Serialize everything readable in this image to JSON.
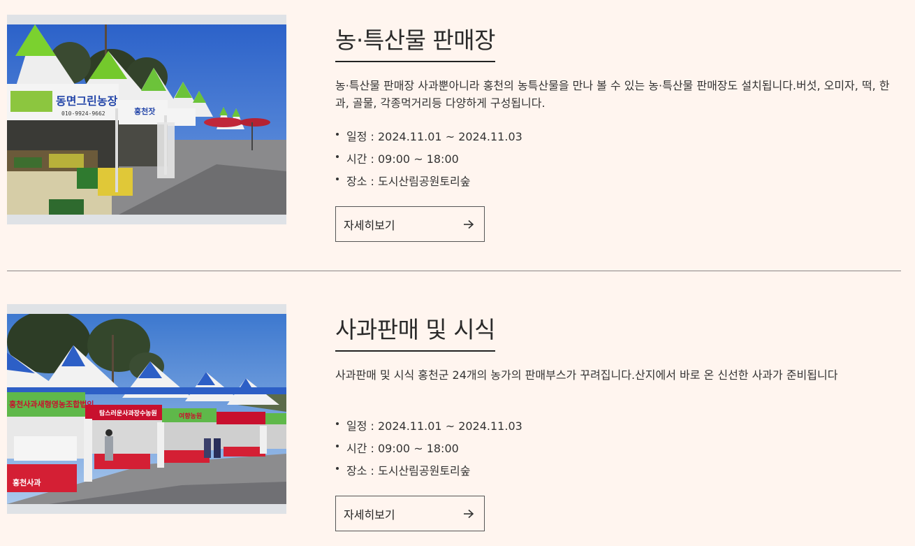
{
  "events": [
    {
      "title": "농·특산물 판매장",
      "description": "농·특산물 판매장 사과뿐아니라 홍천의 농특산물을 만나 볼 수 있는 농·특산물 판매장도 설치됩니다.버섯, 오미자, 떡, 한과, 골물, 각종먹거리등 다양하게 구성됩니다.",
      "date": "일정 : 2024.11.01 ~ 2024.11.03",
      "time": "시간 : 09:00 ~ 18:00",
      "place": "장소 : 도시산림공원토리숲",
      "more_label": "자세히보기",
      "signs": [
        "동면그린농장",
        "010-9924-9662",
        "홍천잣"
      ]
    },
    {
      "title": "사과판매 및 시식",
      "description": "사과판매 및 시식 홍천군 24개의 농가의 판매부스가 꾸려집니다.산지에서 바로 온 신선한 사과가 준비됩니다",
      "date": "일정 : 2024.11.01 ~ 2024.11.03",
      "time": "시간 : 09:00 ~ 18:00",
      "place": "장소 : 도시산림공원토리숲",
      "more_label": "자세히보기",
      "signs": [
        "홍천사과새형영농조합법인",
        "탐스러운사과장수농원",
        "여향농원",
        "홍천사과"
      ]
    }
  ],
  "colors": {
    "background": "#fff5ef",
    "text": "#222222",
    "divider": "#8a8686"
  },
  "icons": {
    "more": "arrow-right-icon"
  }
}
